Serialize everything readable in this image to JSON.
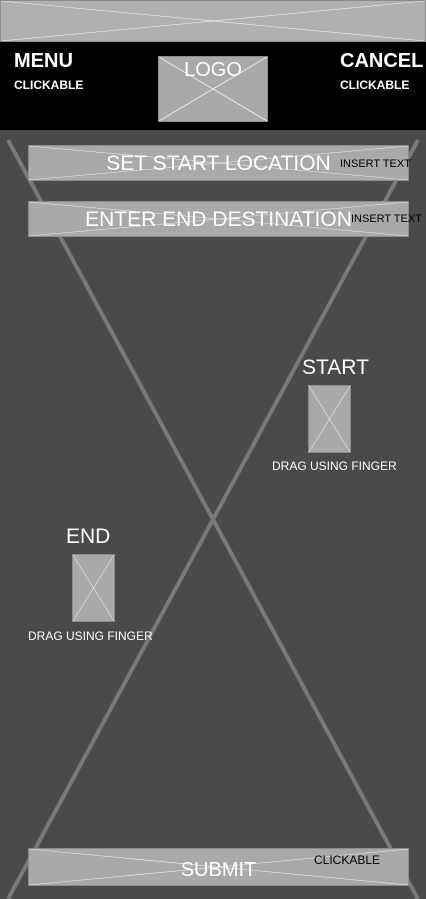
{
  "header": {
    "menu": {
      "label": "MENU",
      "sublabel": "CLICKABLE"
    },
    "logo": {
      "label": "LOGO"
    },
    "cancel": {
      "label": "CANCEL",
      "sublabel": "CLICKABLE"
    }
  },
  "form": {
    "start_location": {
      "label": "SET START LOCATION",
      "hint": "INSERT TEXT"
    },
    "end_destination": {
      "label": "ENTER END DESTINATION",
      "hint": "INSERT TEXT"
    }
  },
  "map": {
    "start_marker": {
      "title": "START",
      "hint": "DRAG USING FINGER"
    },
    "end_marker": {
      "title": "END",
      "hint": "DRAG USING FINGER"
    }
  },
  "submit": {
    "label": "SUBMIT",
    "hint": "CLICKABLE"
  },
  "colors": {
    "background": "#4a4a4a",
    "header": "#000000",
    "placeholder": "#a9a9a9"
  }
}
